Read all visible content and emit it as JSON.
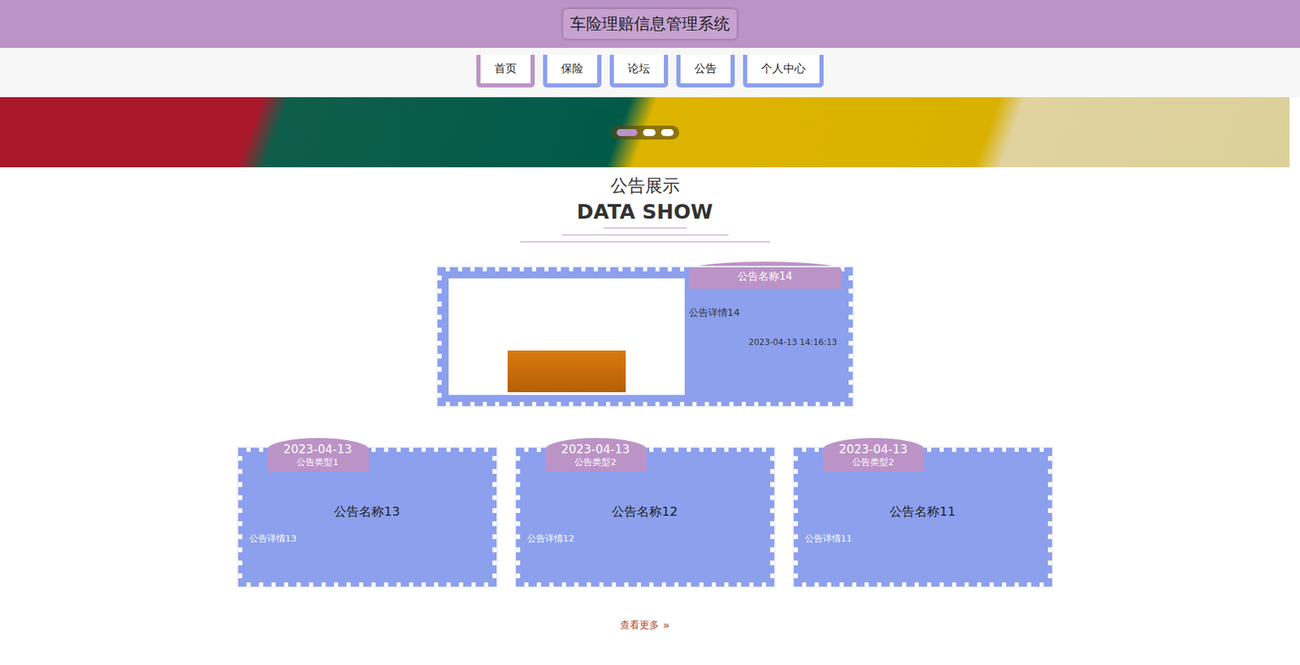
{
  "header": {
    "title": "车险理赔信息管理系统"
  },
  "nav": [
    {
      "label": "首页",
      "selected": true
    },
    {
      "label": "保险",
      "selected": false
    },
    {
      "label": "论坛",
      "selected": false
    },
    {
      "label": "公告",
      "selected": false
    },
    {
      "label": "个人中心",
      "selected": false
    }
  ],
  "banner": {
    "dots": [
      {
        "selected": true
      },
      {
        "selected": false
      },
      {
        "selected": false
      }
    ]
  },
  "section": {
    "title": "公告展示",
    "subtitle": "DATA SHOW"
  },
  "featured": {
    "name": "公告名称14",
    "detail": "公告详情14",
    "time": "2023-04-13 14:16:13"
  },
  "cards": [
    {
      "date": "2023-04-13",
      "type": "公告类型1",
      "name": "公告名称13",
      "detail": "公告详情13"
    },
    {
      "date": "2023-04-13",
      "type": "公告类型2",
      "name": "公告名称12",
      "detail": "公告详情12"
    },
    {
      "date": "2023-04-13",
      "type": "公告类型2",
      "name": "公告名称11",
      "detail": "公告详情11"
    }
  ],
  "more": {
    "label": "查看更多",
    "icon": "»"
  }
}
